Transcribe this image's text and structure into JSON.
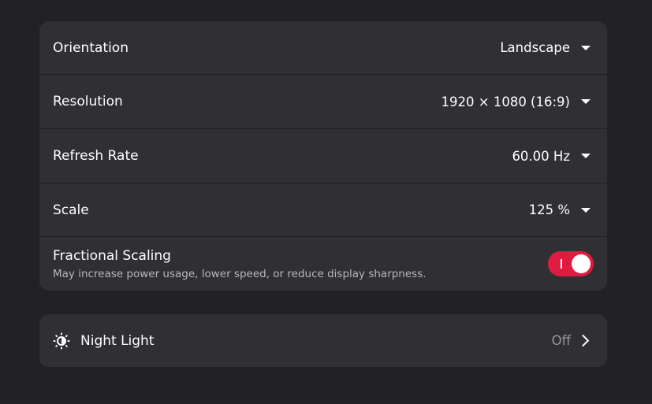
{
  "display": {
    "orientation": {
      "label": "Orientation",
      "value": "Landscape"
    },
    "resolution": {
      "label": "Resolution",
      "value": "1920 × 1080 (16:9)"
    },
    "refresh_rate": {
      "label": "Refresh Rate",
      "value": "60.00 Hz"
    },
    "scale": {
      "label": "Scale",
      "value": "125 %"
    },
    "fractional_scaling": {
      "label": "Fractional Scaling",
      "subtitle": "May increase power usage, lower speed, or reduce display sharpness.",
      "enabled": true
    }
  },
  "night_light": {
    "label": "Night Light",
    "value": "Off",
    "icon": "night-light-icon"
  },
  "colors": {
    "accent": "#e01b40",
    "card": "#303034",
    "background": "#222226"
  }
}
